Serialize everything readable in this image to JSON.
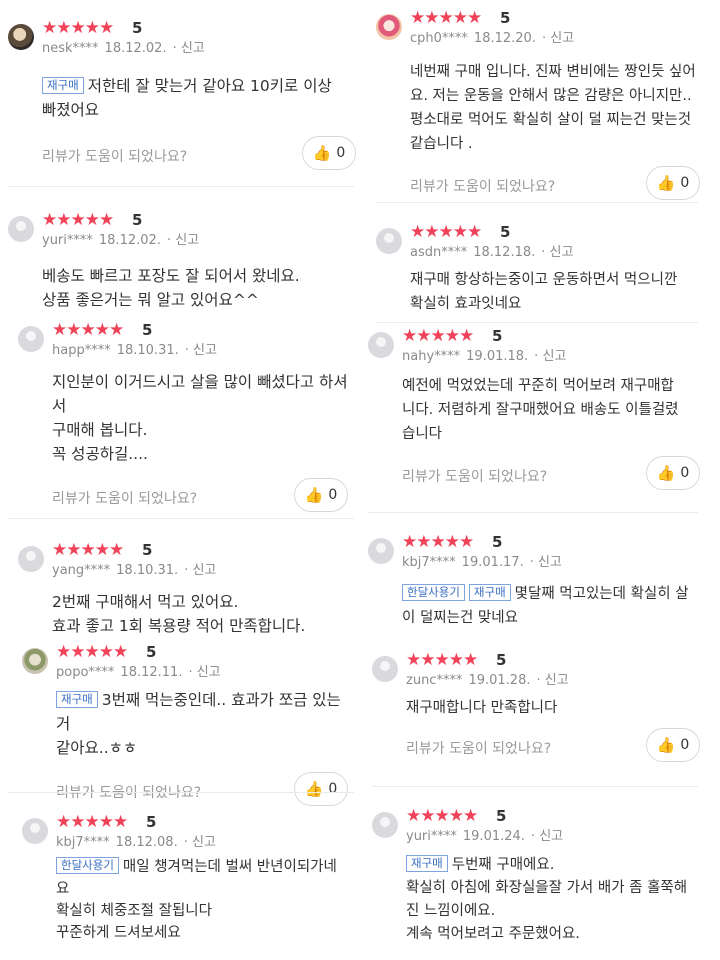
{
  "common": {
    "stars": "★★★★★",
    "report": "신고",
    "helpful": "리뷰가 도움이 되었나요?",
    "likes": "0"
  },
  "reviews": [
    {
      "score": "5",
      "user": "nesk****",
      "date": "18.12.02.",
      "badges": [
        "재구매"
      ],
      "lines": [
        "저한테 잘 맞는거 같아요 10키로 이상",
        "빠졌어요"
      ]
    },
    {
      "score": "5",
      "user": "yuri****",
      "date": "18.12.02.",
      "badges": [],
      "lines": [
        "베송도 빠르고 포장도 잘 되어서 왔네요.",
        "상품 좋은거는 뭐 알고 있어요^^"
      ]
    },
    {
      "score": "5",
      "user": "happ****",
      "date": "18.10.31.",
      "badges": [],
      "lines": [
        "지인분이 이거드시고 살을 많이 빼셨다고 하셔",
        "서",
        "구매해 봅니다.",
        "꼭 성공하길...."
      ]
    },
    {
      "score": "5",
      "user": "yang****",
      "date": "18.10.31.",
      "badges": [],
      "lines": [
        "2번째 구매해서 먹고 있어요.",
        "효과 좋고 1회 복용량 적어 만족합니다."
      ]
    },
    {
      "score": "5",
      "user": "popo****",
      "date": "18.12.11.",
      "badges": [
        "재구매"
      ],
      "lines": [
        "3번째 먹는중인데.. 효과가 쪼금 있는거",
        "같아요..ㅎㅎ"
      ]
    },
    {
      "score": "5",
      "user": "kbj7****",
      "date": "18.12.08.",
      "badges": [
        "한달사용기"
      ],
      "lines": [
        "매일 챙겨먹는데 벌써 반년이되가네",
        "요",
        "확실히 체중조절 잘됩니다",
        "꾸준하게 드셔보세요"
      ]
    },
    {
      "score": "5",
      "user": "cph0****",
      "date": "18.12.20.",
      "badges": [],
      "lines": [
        "네번째 구매 입니다. 진짜 변비에는 짱인듯 싶어",
        "요. 저는 운동을 안해서 많은 감량은 아니지만..",
        "평소대로 먹어도 확실히 살이 덜 찌는건 맞는것",
        "같습니다 ."
      ]
    },
    {
      "score": "5",
      "user": "asdn****",
      "date": "18.12.18.",
      "badges": [],
      "lines": [
        "재구매 항상하는중이고 운동하면서 먹으니깐",
        "확실히 효과잇네요"
      ]
    },
    {
      "score": "5",
      "user": "nahy****",
      "date": "19.01.18.",
      "badges": [],
      "lines": [
        "예전에 먹었었는데 꾸준히 먹어보려 재구매합",
        "니다. 저렴하게 잘구매했어요 배송도 이틀걸렸",
        "습니다"
      ]
    },
    {
      "score": "5",
      "user": "kbj7****",
      "date": "19.01.17.",
      "badges": [
        "한달사용기",
        "재구매"
      ],
      "lines": [
        "몇달째 먹고있는데 확실히 살",
        "이 덜찌는건 맞네요"
      ]
    },
    {
      "score": "5",
      "user": "zunc****",
      "date": "19.01.28.",
      "badges": [],
      "lines": [
        "재구매합니다 만족합니다"
      ]
    },
    {
      "score": "5",
      "user": "yuri****",
      "date": "19.01.24.",
      "badges": [
        "재구매"
      ],
      "lines": [
        "두번째 구매에요.",
        "확실히 아침에 화장실을잘 가서 배가 좀 홀쭉해",
        "진 느낌이에요.",
        "계속 먹어보려고 주문했어요."
      ]
    }
  ]
}
